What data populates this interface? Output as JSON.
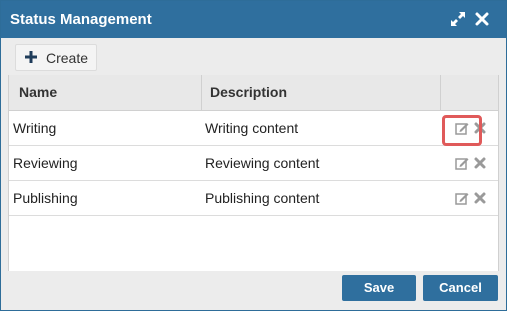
{
  "dialog": {
    "title": "Status Management",
    "maximize_icon": "expand-arrows-icon",
    "close_icon": "close-x-icon"
  },
  "toolbar": {
    "create_label": "Create",
    "create_icon": "plus-icon"
  },
  "table": {
    "columns": [
      "Name",
      "Description"
    ],
    "rows": [
      {
        "name": "Writing",
        "description": "Writing content"
      },
      {
        "name": "Reviewing",
        "description": "Reviewing content"
      },
      {
        "name": "Publishing",
        "description": "Publishing content"
      }
    ],
    "row_actions": [
      "edit-icon",
      "delete-icon"
    ]
  },
  "footer": {
    "save_label": "Save",
    "cancel_label": "Cancel"
  },
  "colors": {
    "primary": "#2f6f9e",
    "highlight": "#e05a5a",
    "icon_gray": "#9a9a9a"
  }
}
